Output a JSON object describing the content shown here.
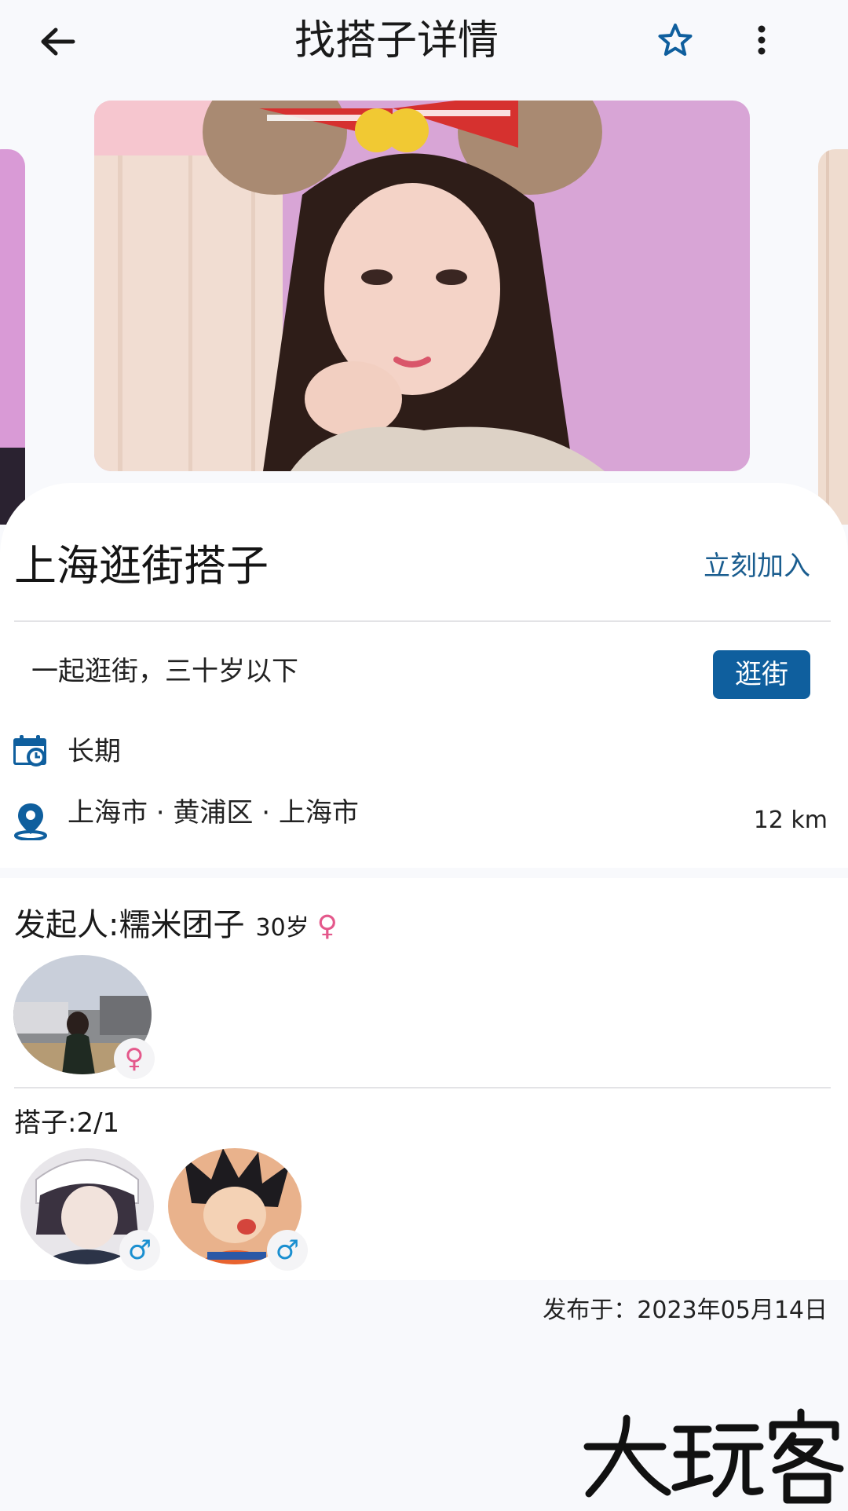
{
  "header": {
    "title": "找搭子详情",
    "icons": [
      "back-arrow-icon",
      "star-icon",
      "more-vertical-icon"
    ]
  },
  "detail": {
    "title": "上海逛街搭子",
    "join_label": "立刻加入",
    "description": "一起逛街，三十岁以下",
    "tag": "逛街",
    "duration": "长期",
    "location": "上海市 · 黄浦区 · 上海市",
    "distance": "12 km"
  },
  "initiator": {
    "label": "发起人:",
    "name": "糯米团子",
    "age": "30岁",
    "gender": "♀"
  },
  "partners": {
    "label": "搭子:2/1",
    "members": [
      {
        "gender": "♂"
      },
      {
        "gender": "♂"
      }
    ]
  },
  "footer": {
    "published": "发布于：2023年05月14日",
    "watermark": "大玩客"
  },
  "colors": {
    "accent": "#0f5f9e",
    "link": "#1a5d8f",
    "female": "#e4588b",
    "male": "#1a8fd0",
    "background": "#f8f9fc"
  }
}
